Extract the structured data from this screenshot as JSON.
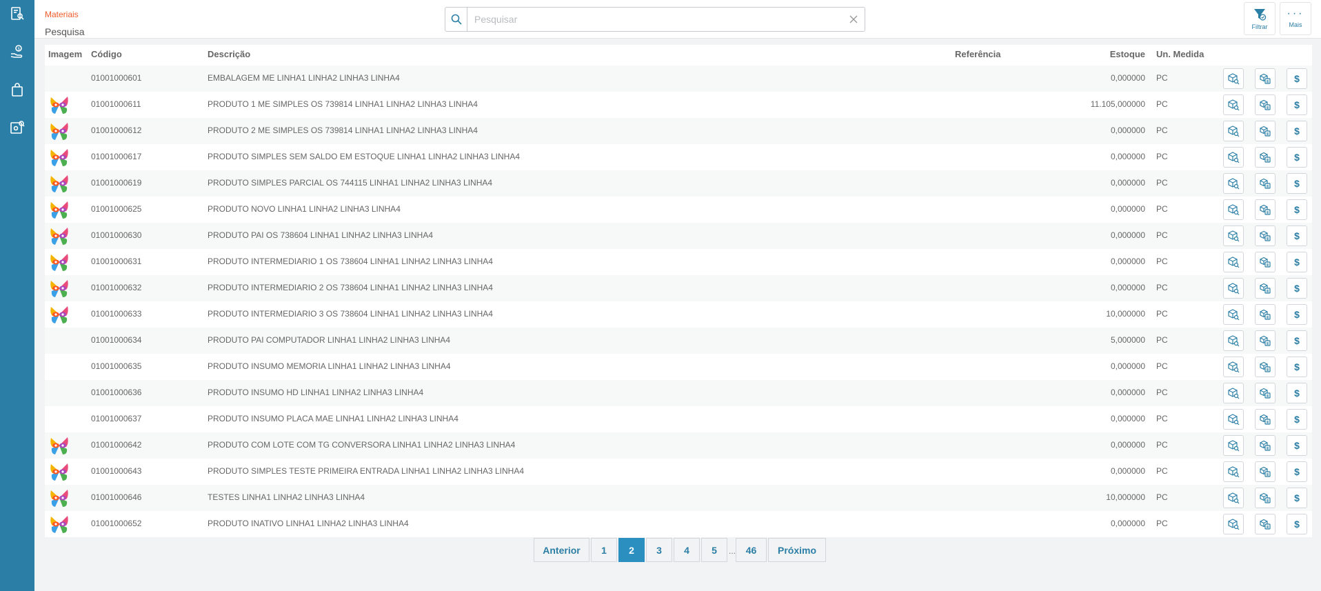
{
  "sidebar": {
    "items": [
      {
        "icon": "report-search-icon"
      },
      {
        "icon": "money-hand-icon"
      },
      {
        "icon": "shopping-bag-icon"
      },
      {
        "icon": "gear-search-icon"
      }
    ]
  },
  "header": {
    "breadcrumb": "Materiais",
    "title": "Pesquisa",
    "search_placeholder": "Pesquisar",
    "filter_label": "Filtrar",
    "more_label": "Mais"
  },
  "table": {
    "columns": {
      "image": "Imagem",
      "code": "Código",
      "description": "Descrição",
      "reference": "Referência",
      "stock": "Estoque",
      "unit": "Un. Medida"
    },
    "rows": [
      {
        "has_image": false,
        "code": "01001000601",
        "description": "EMBALAGEM ME LINHA1 LINHA2 LINHA3 LINHA4",
        "reference": "",
        "stock": "0,000000",
        "unit": "PC"
      },
      {
        "has_image": true,
        "code": "01001000611",
        "description": "PRODUTO 1 ME SIMPLES OS 739814 LINHA1 LINHA2 LINHA3 LINHA4",
        "reference": "",
        "stock": "11.105,000000",
        "unit": "PC"
      },
      {
        "has_image": true,
        "code": "01001000612",
        "description": "PRODUTO 2 ME SIMPLES OS 739814 LINHA1 LINHA2 LINHA3 LINHA4",
        "reference": "",
        "stock": "0,000000",
        "unit": "PC"
      },
      {
        "has_image": true,
        "code": "01001000617",
        "description": "PRODUTO SIMPLES SEM SALDO EM ESTOQUE LINHA1 LINHA2 LINHA3 LINHA4",
        "reference": "",
        "stock": "0,000000",
        "unit": "PC"
      },
      {
        "has_image": true,
        "code": "01001000619",
        "description": "PRODUTO SIMPLES PARCIAL OS 744115 LINHA1 LINHA2 LINHA3 LINHA4",
        "reference": "",
        "stock": "0,000000",
        "unit": "PC"
      },
      {
        "has_image": true,
        "code": "01001000625",
        "description": "PRODUTO NOVO LINHA1 LINHA2 LINHA3 LINHA4",
        "reference": "",
        "stock": "0,000000",
        "unit": "PC"
      },
      {
        "has_image": true,
        "code": "01001000630",
        "description": "PRODUTO PAI OS 738604 LINHA1 LINHA2 LINHA3 LINHA4",
        "reference": "",
        "stock": "0,000000",
        "unit": "PC"
      },
      {
        "has_image": true,
        "code": "01001000631",
        "description": "PRODUTO INTERMEDIARIO 1 OS 738604 LINHA1 LINHA2 LINHA3 LINHA4",
        "reference": "",
        "stock": "0,000000",
        "unit": "PC"
      },
      {
        "has_image": true,
        "code": "01001000632",
        "description": "PRODUTO INTERMEDIARIO 2 OS 738604 LINHA1 LINHA2 LINHA3 LINHA4",
        "reference": "",
        "stock": "0,000000",
        "unit": "PC"
      },
      {
        "has_image": true,
        "code": "01001000633",
        "description": "PRODUTO INTERMEDIARIO 3 OS 738604 LINHA1 LINHA2 LINHA3 LINHA4",
        "reference": "",
        "stock": "10,000000",
        "unit": "PC"
      },
      {
        "has_image": false,
        "code": "01001000634",
        "description": "PRODUTO PAI COMPUTADOR LINHA1 LINHA2 LINHA3 LINHA4",
        "reference": "",
        "stock": "5,000000",
        "unit": "PC"
      },
      {
        "has_image": false,
        "code": "01001000635",
        "description": "PRODUTO INSUMO MEMORIA LINHA1 LINHA2 LINHA3 LINHA4",
        "reference": "",
        "stock": "0,000000",
        "unit": "PC"
      },
      {
        "has_image": false,
        "code": "01001000636",
        "description": "PRODUTO INSUMO HD LINHA1 LINHA2 LINHA3 LINHA4",
        "reference": "",
        "stock": "0,000000",
        "unit": "PC"
      },
      {
        "has_image": false,
        "code": "01001000637",
        "description": "PRODUTO INSUMO PLACA MAE LINHA1 LINHA2 LINHA3 LINHA4",
        "reference": "",
        "stock": "0,000000",
        "unit": "PC"
      },
      {
        "has_image": true,
        "code": "01001000642",
        "description": "PRODUTO COM LOTE COM TG CONVERSORA LINHA1 LINHA2 LINHA3 LINHA4",
        "reference": "",
        "stock": "0,000000",
        "unit": "PC"
      },
      {
        "has_image": true,
        "code": "01001000643",
        "description": "PRODUTO SIMPLES TESTE PRIMEIRA ENTRADA LINHA1 LINHA2 LINHA3 LINHA4",
        "reference": "",
        "stock": "0,000000",
        "unit": "PC"
      },
      {
        "has_image": true,
        "code": "01001000646",
        "description": "TESTES LINHA1 LINHA2 LINHA3 LINHA4",
        "reference": "",
        "stock": "10,000000",
        "unit": "PC"
      },
      {
        "has_image": true,
        "code": "01001000652",
        "description": "PRODUTO INATIVO LINHA1 LINHA2 LINHA3 LINHA4",
        "reference": "",
        "stock": "0,000000",
        "unit": "PC"
      }
    ],
    "actions": {
      "stock_icon": "box-search-icon",
      "copy_icon": "box-copy-icon",
      "price_symbol": "$"
    }
  },
  "pagination": {
    "previous": "Anterior",
    "next": "Próximo",
    "pages": [
      "1",
      "2",
      "3",
      "4",
      "5"
    ],
    "current": "2",
    "ellipsis": "...",
    "last": "46"
  },
  "colors": {
    "sidebar": "#2b7ea5",
    "accent": "#2b7ea5",
    "breadcrumb": "#f05a28",
    "active_page": "#2b8fc0"
  }
}
